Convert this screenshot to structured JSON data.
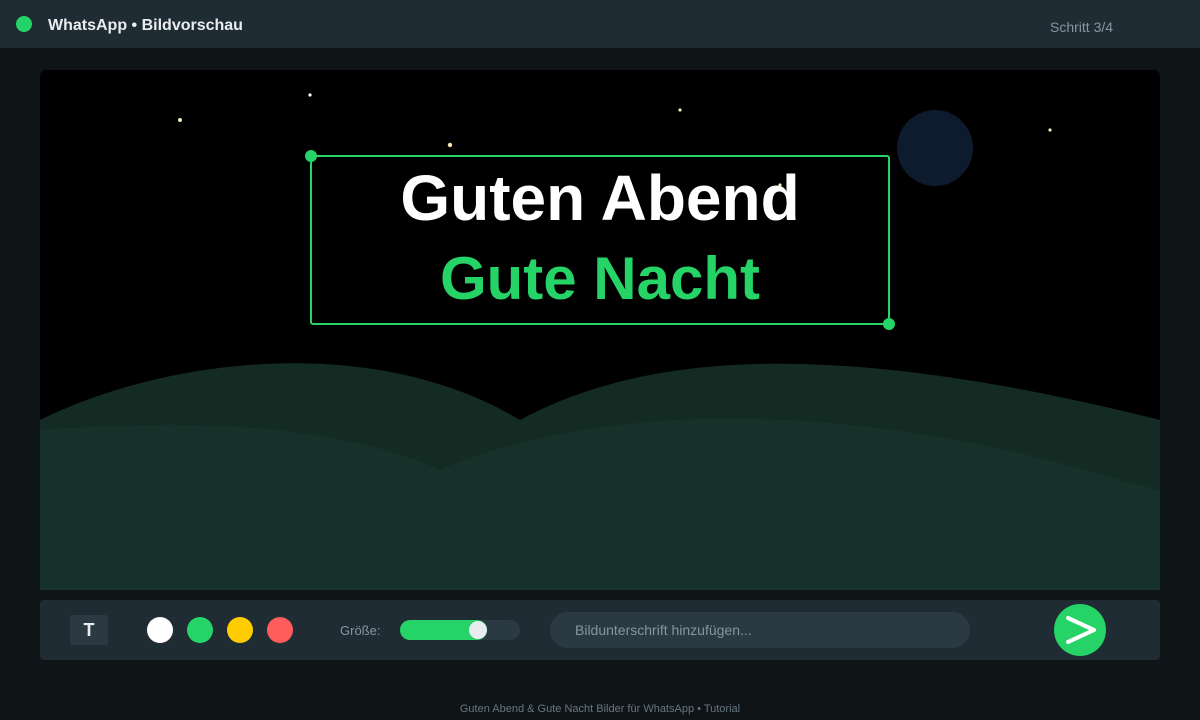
{
  "header": {
    "title": "WhatsApp • Bildvorschau",
    "step": "Schritt 3/4",
    "status_color": "#25d366"
  },
  "canvas": {
    "scene": "night sky with stars, moon and green hills",
    "text_line_1": "Guten Abend",
    "text_line_2": "Gute Nacht",
    "text_line_1_color": "#ffffff",
    "text_line_2_color": "#25d366"
  },
  "toolbar": {
    "text_tool_label": "T",
    "colors": [
      "#ffffff",
      "#25d366",
      "#ffcc00",
      "#ff5c5c"
    ],
    "size_label": "Größe:",
    "size_value_fraction": 0.65,
    "caption_placeholder": "Bildunterschrift hinzufügen...",
    "caption_value": "",
    "send_icon": "send-arrow-icon"
  },
  "footer": {
    "text": "Guten Abend & Gute Nacht Bilder für WhatsApp • Tutorial"
  }
}
